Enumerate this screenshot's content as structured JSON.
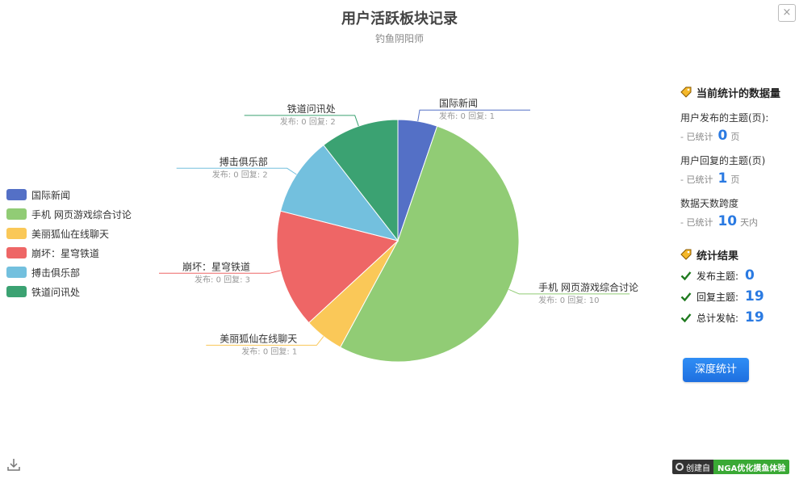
{
  "header": {
    "title": "用户活跃板块记录",
    "subtitle": "钓鱼阴阳师",
    "close_label": "×"
  },
  "chart_data": {
    "type": "pie",
    "title": "用户活跃板块记录",
    "subtitle": "钓鱼阴阳师",
    "categories": [
      "国际新闻",
      "手机 网页游戏综合讨论",
      "美丽狐仙在线聊天",
      "崩坏：星穹铁道",
      "搏击俱乐部",
      "铁道问讯处"
    ],
    "values": [
      1,
      10,
      1,
      3,
      2,
      2
    ],
    "sublabels": [
      "发布: 0 回复: 1",
      "发布: 0 回复: 10",
      "发布: 0 回复: 1",
      "发布: 0 回复: 3",
      "发布: 0 回复: 2",
      "发布: 0 回复: 2"
    ],
    "colors": [
      "#5470c6",
      "#91cc75",
      "#fac858",
      "#ee6666",
      "#73c0de",
      "#3ba272"
    ],
    "legend_position": "left"
  },
  "panel": {
    "data_title": "当前统计的数据量",
    "stats": [
      {
        "label": "用户发布的主题(页):",
        "prefix": "- 已统计",
        "value": "0",
        "unit": "页"
      },
      {
        "label": "用户回复的主题(页)",
        "prefix": "- 已统计",
        "value": "1",
        "unit": "页"
      },
      {
        "label": "数据天数跨度",
        "prefix": "- 已统计",
        "value": "10",
        "unit": "天内"
      }
    ],
    "result_title": "统计结果",
    "results": [
      {
        "label": "发布主题:",
        "value": "0"
      },
      {
        "label": "回复主题:",
        "value": "19"
      },
      {
        "label": "总计发帖:",
        "value": "19"
      }
    ],
    "deep_button": "深度统计"
  },
  "badge": {
    "left": "创建自",
    "right": "NGA优化摸鱼体验"
  },
  "colors": {
    "accent": "#2a7ae2",
    "badge_green": "#3aa935"
  }
}
